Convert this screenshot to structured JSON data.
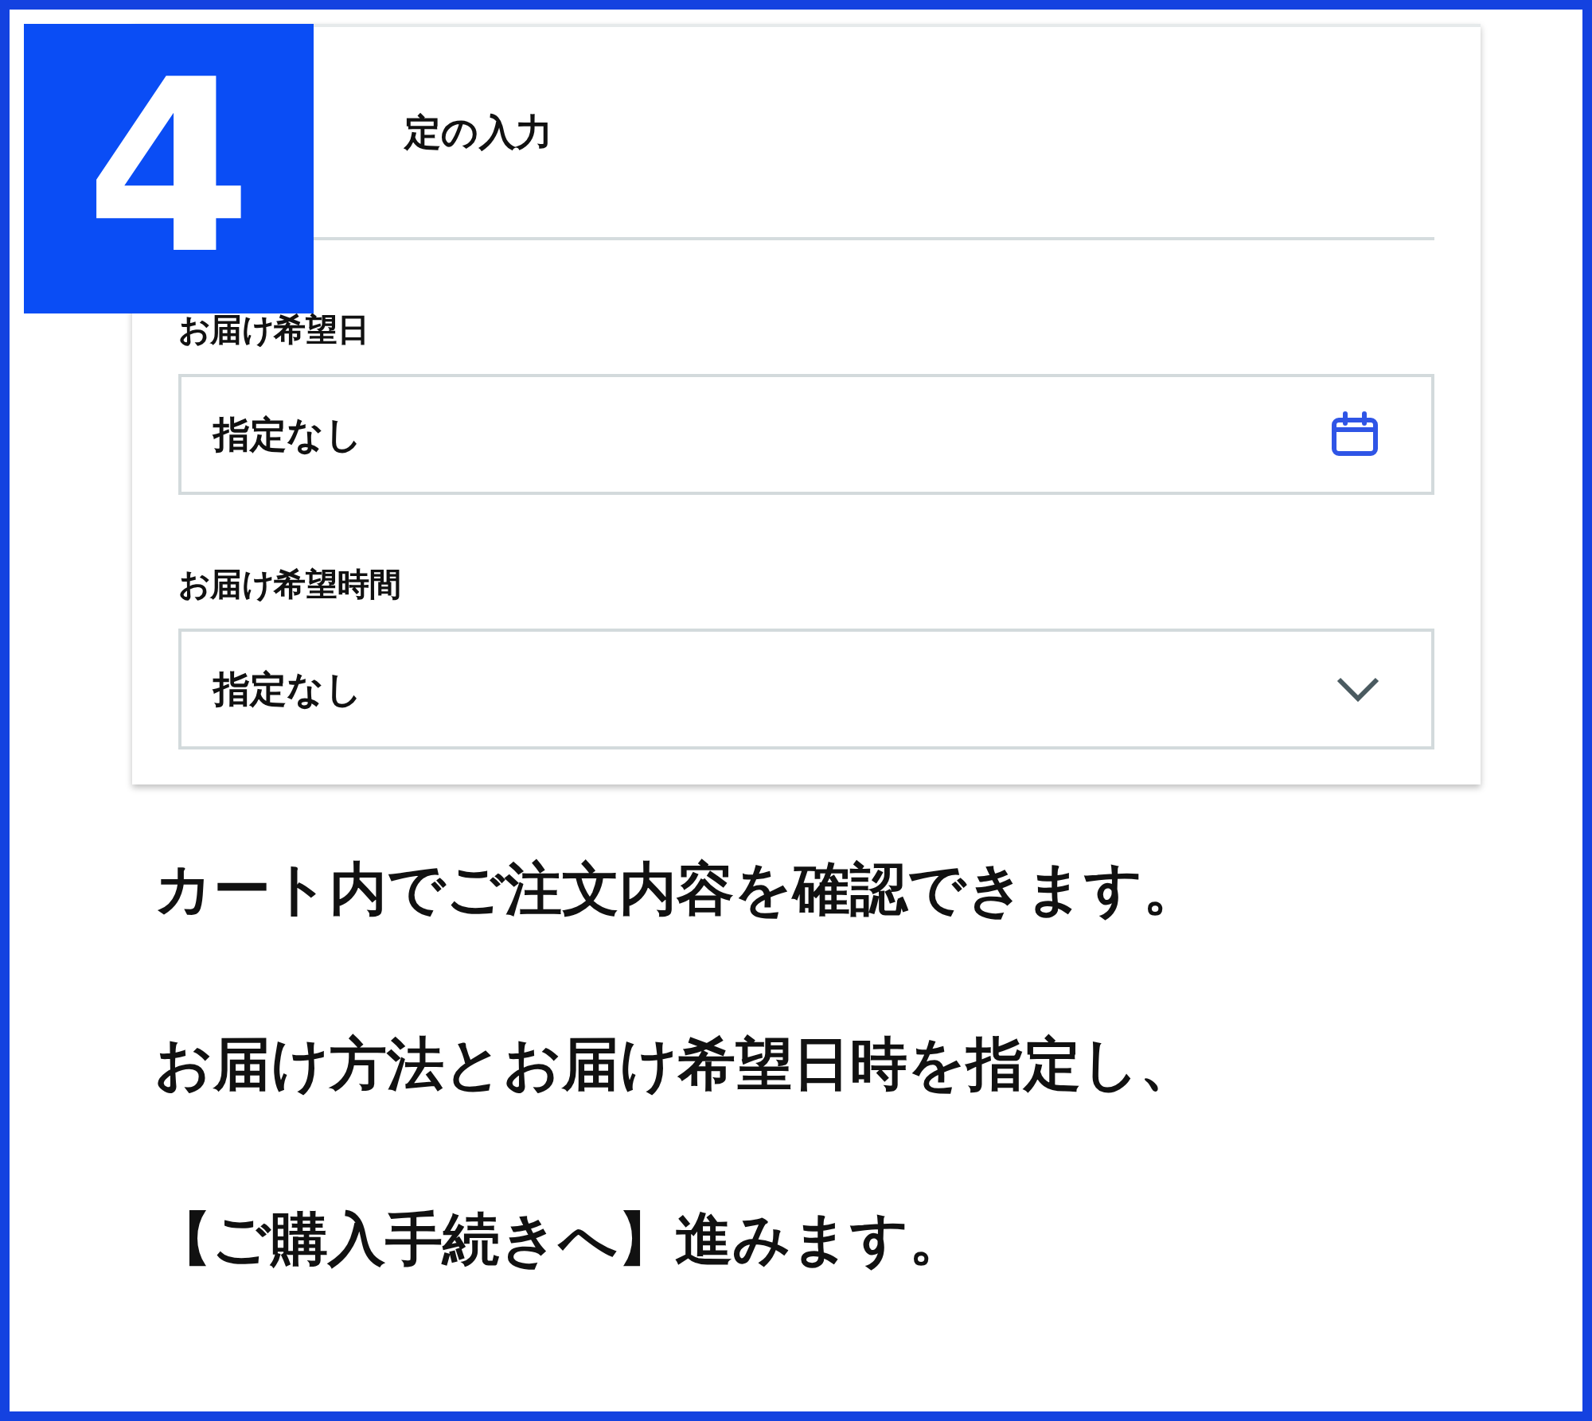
{
  "step_badge": "4",
  "card": {
    "heading": "定の入力",
    "fields": [
      {
        "kind": "date",
        "label": "お届け希望日",
        "value": "指定なし"
      },
      {
        "kind": "select",
        "label": "お届け希望時間",
        "value": "指定なし"
      }
    ]
  },
  "instructions": [
    "カート内でご注文内容を確認できます。",
    "お届け方法とお届け希望日時を指定し、",
    "【ご購入手続きへ】進みます。"
  ]
}
